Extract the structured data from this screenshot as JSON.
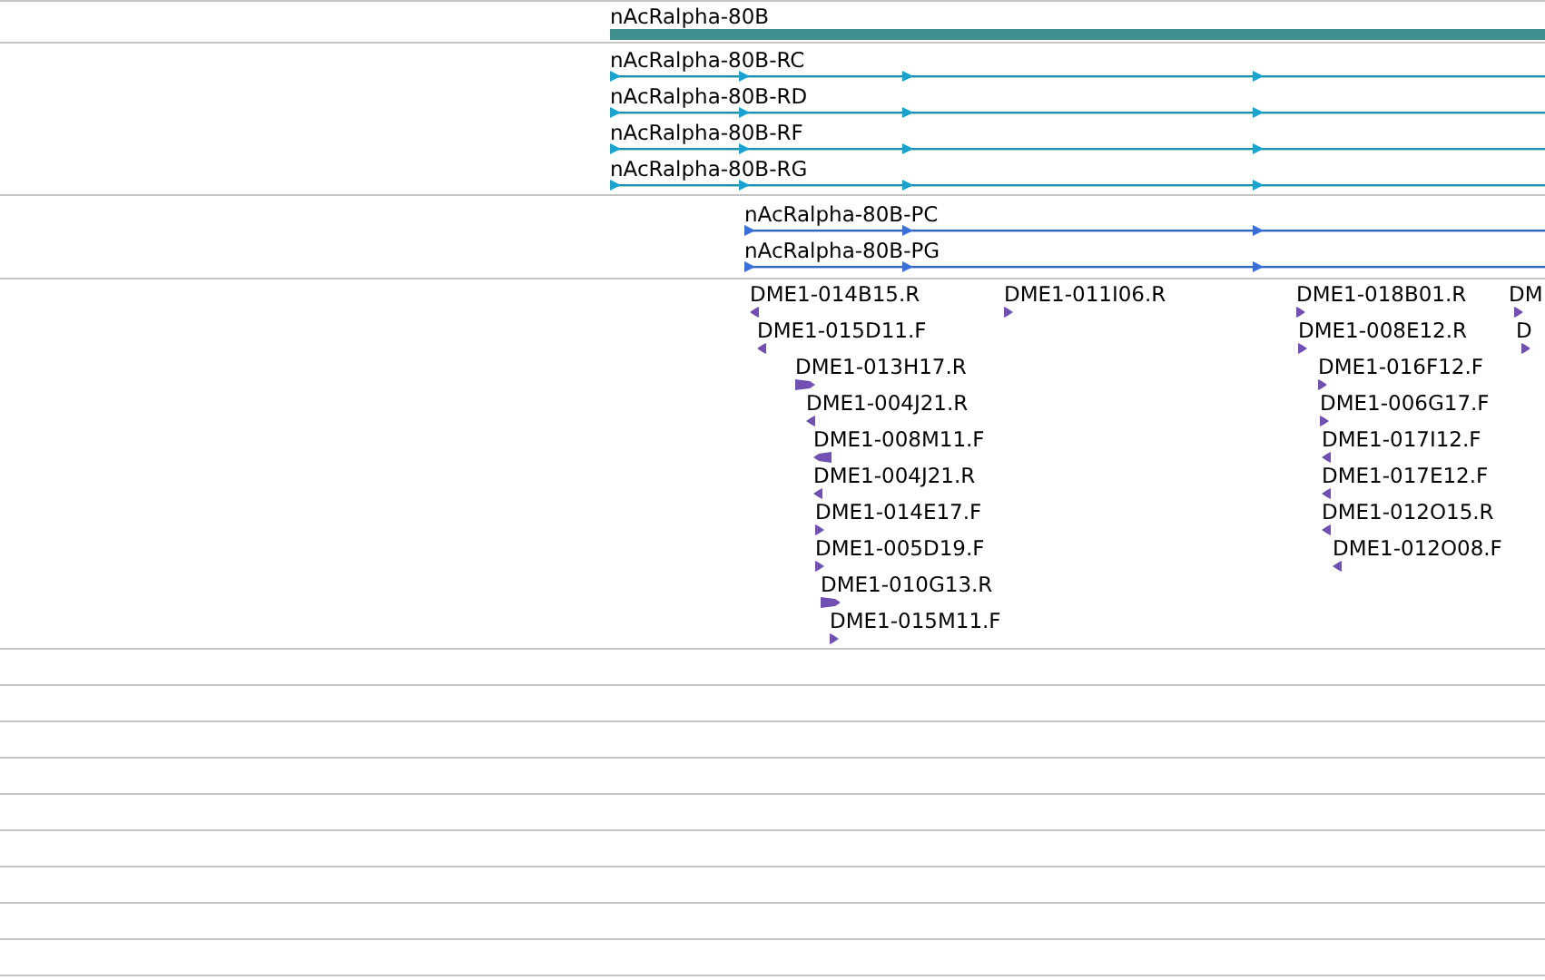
{
  "tracks": [
    {
      "kind": "gene",
      "features": [
        {
          "label": "nAcRalpha-80B"
        }
      ]
    },
    {
      "kind": "transcript",
      "features": [
        {
          "label": "nAcRalpha-80B-RC"
        },
        {
          "label": "nAcRalpha-80B-RD"
        },
        {
          "label": "nAcRalpha-80B-RF"
        },
        {
          "label": "nAcRalpha-80B-RG"
        }
      ]
    },
    {
      "kind": "protein",
      "features": [
        {
          "label": "nAcRalpha-80B-PC"
        },
        {
          "label": "nAcRalpha-80B-PG"
        }
      ]
    },
    {
      "kind": "est",
      "features": [
        {
          "label": "DME1-014B15.R",
          "kind": "reverse"
        },
        {
          "label": "DME1-015D11.F",
          "kind": "reverse"
        },
        {
          "label": "DME1-013H17.R",
          "kind": "forward"
        },
        {
          "label": "DME1-004J21.R",
          "kind": "reverse"
        },
        {
          "label": "DME1-008M11.F",
          "kind": "reverse"
        },
        {
          "label": "DME1-004J21.R",
          "kind": "reverse"
        },
        {
          "label": "DME1-014E17.F",
          "kind": "forward"
        },
        {
          "label": "DME1-005D19.F",
          "kind": "forward"
        },
        {
          "label": "DME1-010G13.R",
          "kind": "forward"
        },
        {
          "label": "DME1-015M11.F",
          "kind": "forward"
        },
        {
          "label": "DME1-011I06.R",
          "kind": "forward"
        },
        {
          "label": "DME1-018B01.R",
          "kind": "forward"
        },
        {
          "label": "DME1-008E12.R",
          "kind": "forward"
        },
        {
          "label": "DME1-016F12.F",
          "kind": "forward"
        },
        {
          "label": "DME1-006G17.F",
          "kind": "forward"
        },
        {
          "label": "DME1-017I12.F",
          "kind": "reverse"
        },
        {
          "label": "DME1-017E12.F",
          "kind": "reverse"
        },
        {
          "label": "DME1-012O15.R",
          "kind": "reverse"
        },
        {
          "label": "DME1-012O08.F",
          "kind": "reverse"
        },
        {
          "label": "DM",
          "kind": "forward"
        },
        {
          "label": "D",
          "kind": "forward"
        }
      ]
    }
  ]
}
